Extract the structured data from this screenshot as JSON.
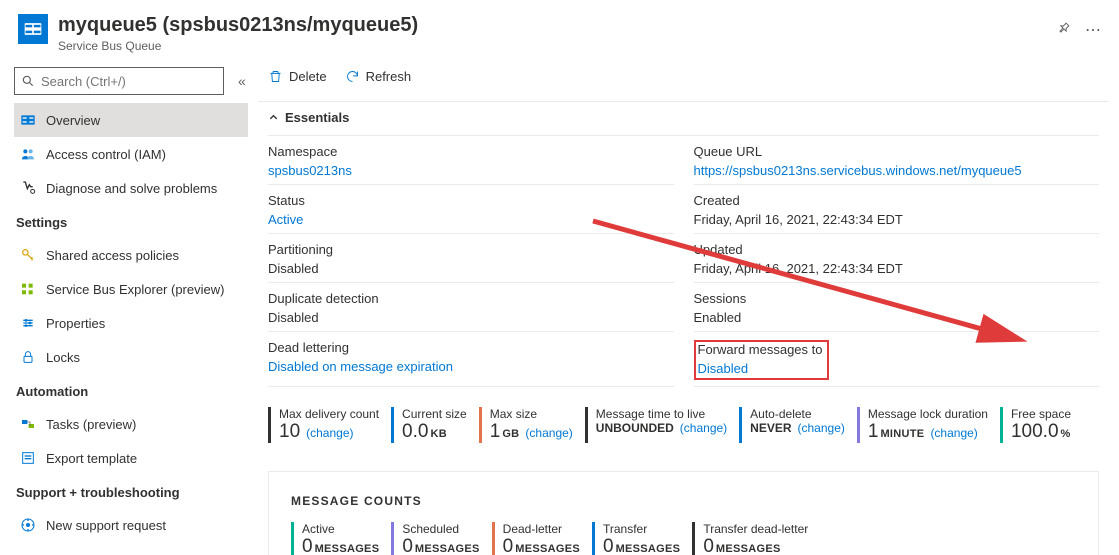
{
  "header": {
    "title": "myqueue5 (spsbus0213ns/myqueue5)",
    "subtitle": "Service Bus Queue"
  },
  "sidebar": {
    "search_placeholder": "Search (Ctrl+/)",
    "top_items": [
      {
        "label": "Overview",
        "icon": "overview",
        "selected": true
      },
      {
        "label": "Access control (IAM)",
        "icon": "iam"
      },
      {
        "label": "Diagnose and solve problems",
        "icon": "diagnose"
      }
    ],
    "sections": [
      {
        "title": "Settings",
        "items": [
          {
            "label": "Shared access policies",
            "icon": "key"
          },
          {
            "label": "Service Bus Explorer (preview)",
            "icon": "explorer"
          },
          {
            "label": "Properties",
            "icon": "properties"
          },
          {
            "label": "Locks",
            "icon": "lock"
          }
        ]
      },
      {
        "title": "Automation",
        "items": [
          {
            "label": "Tasks (preview)",
            "icon": "tasks"
          },
          {
            "label": "Export template",
            "icon": "export"
          }
        ]
      },
      {
        "title": "Support + troubleshooting",
        "items": [
          {
            "label": "New support request",
            "icon": "support"
          }
        ]
      }
    ]
  },
  "toolbar": {
    "delete": "Delete",
    "refresh": "Refresh"
  },
  "essentials": {
    "heading": "Essentials",
    "left": [
      {
        "label": "Namespace",
        "value": "spsbus0213ns",
        "link": true
      },
      {
        "label": "Status",
        "value": "Active",
        "link": true
      },
      {
        "label": "Partitioning",
        "value": "Disabled"
      },
      {
        "label": "Duplicate detection",
        "value": "Disabled"
      },
      {
        "label": "Dead lettering",
        "value": "Disabled on message expiration",
        "link": true
      }
    ],
    "right": [
      {
        "label": "Queue URL",
        "value": "https://spsbus0213ns.servicebus.windows.net/myqueue5",
        "link": true
      },
      {
        "label": "Created",
        "value": "Friday, April 16, 2021, 22:43:34 EDT"
      },
      {
        "label": "Updated",
        "value": "Friday, April 16, 2021, 22:43:34 EDT"
      },
      {
        "label": "Sessions",
        "value": "Enabled"
      },
      {
        "label": "Forward messages to",
        "value": "Disabled",
        "link": true,
        "highlighted": true
      }
    ]
  },
  "metrics": [
    {
      "label": "Max delivery count",
      "value": "10",
      "unit": "",
      "change": "(change)",
      "color": "#323130"
    },
    {
      "label": "Current size",
      "value": "0.0",
      "unit": "KB",
      "color": "#0078d4"
    },
    {
      "label": "Max size",
      "value": "1",
      "unit": "GB",
      "change": "(change)",
      "color": "#e3734e"
    },
    {
      "label": "Message time to live",
      "value": "UNBOUNDED",
      "unit": "",
      "change": "(change)",
      "color": "#323130",
      "small": true
    },
    {
      "label": "Auto-delete",
      "value": "NEVER",
      "unit": "",
      "change": "(change)",
      "color": "#0078d4",
      "small": true
    },
    {
      "label": "Message lock duration",
      "value": "1",
      "unit": "MINUTE",
      "change": "(change)",
      "color": "#8378de"
    },
    {
      "label": "Free space",
      "value": "100.0",
      "unit": "%",
      "color": "#00b294"
    }
  ],
  "message_counts": {
    "title": "MESSAGE COUNTS",
    "items": [
      {
        "label": "Active",
        "value": "0",
        "unit": "MESSAGES",
        "color": "#00b294"
      },
      {
        "label": "Scheduled",
        "value": "0",
        "unit": "MESSAGES",
        "color": "#8378de"
      },
      {
        "label": "Dead-letter",
        "value": "0",
        "unit": "MESSAGES",
        "color": "#e3734e"
      },
      {
        "label": "Transfer",
        "value": "0",
        "unit": "MESSAGES",
        "color": "#0078d4"
      },
      {
        "label": "Transfer dead-letter",
        "value": "0",
        "unit": "MESSAGES",
        "color": "#323130"
      }
    ]
  },
  "change_text": "(change)"
}
